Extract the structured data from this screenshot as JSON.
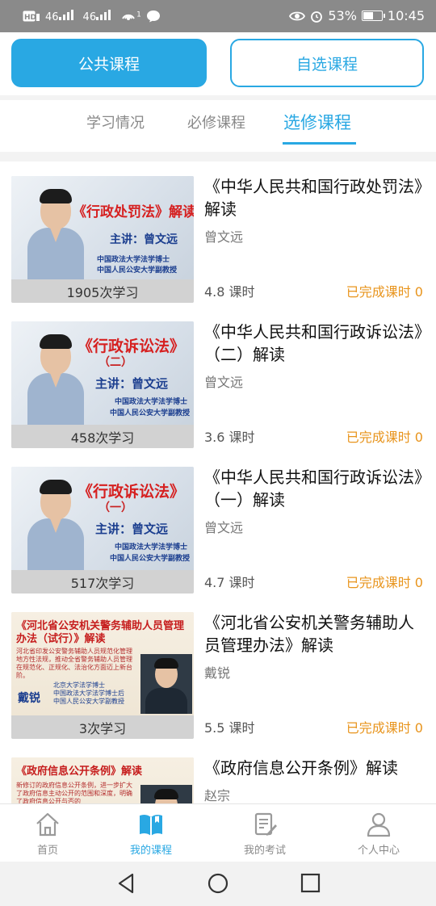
{
  "status_bar": {
    "left_icons": [
      "hd-icon",
      "4g-signal-icon",
      "4g-signal-icon",
      "hotspot-icon",
      "chat-icon"
    ],
    "signal_labels": [
      "46",
      "46"
    ],
    "hotspot_count": "1",
    "battery_percent": "53%",
    "battery_level": 0.53,
    "time": "10:45"
  },
  "top_buttons": {
    "public": "公共课程",
    "elective": "自选课程"
  },
  "tabs": [
    {
      "label": "学习情况",
      "active": false
    },
    {
      "label": "必修课程",
      "active": false
    },
    {
      "label": "选修课程",
      "active": true
    }
  ],
  "courses": [
    {
      "title": "《中华人民共和国行政处罚法》解读",
      "teacher": "曾文远",
      "hours": "4.8 课时",
      "completed": "已完成课时 0",
      "study_count": "1905次学习",
      "thumb": {
        "title": "《行政处罚法》解读",
        "sub": "",
        "speaker": "主讲：曾文远",
        "cred": [
          "中国政法大学法学博士",
          "中国人民公安大学副教授"
        ]
      }
    },
    {
      "title": "《中华人民共和国行政诉讼法》（二）解读",
      "teacher": "曾文远",
      "hours": "3.6 课时",
      "completed": "已完成课时 0",
      "study_count": "458次学习",
      "thumb": {
        "title": "《行政诉讼法》",
        "sub": "（二）",
        "speaker": "主讲：曾文远",
        "cred": [
          "中国政法大学法学博士",
          "中国人民公安大学副教授"
        ]
      }
    },
    {
      "title": "《中华人民共和国行政诉讼法》（一）解读",
      "teacher": "曾文远",
      "hours": "4.7 课时",
      "completed": "已完成课时 0",
      "study_count": "517次学习",
      "thumb": {
        "title": "《行政诉讼法》",
        "sub": "（一）",
        "speaker": "主讲：曾文远",
        "cred": [
          "中国政法大学法学博士",
          "中国人民公安大学副教授"
        ]
      }
    },
    {
      "title": "《河北省公安机关警务辅助人员管理办法》解读",
      "teacher": "戴锐",
      "hours": "5.5 课时",
      "completed": "已完成课时 0",
      "study_count": "3次学习",
      "thumb": {
        "title": "《河北省公安机关警务辅助人员管理办法（试行）》解读",
        "desc": "河北省印发公安警务辅助人员规范化管理地方性法规，推动全省警务辅助人员管理在规范化、正规化、法治化方面迈上新台阶。",
        "speaker": "戴锐",
        "cred": [
          "北京大学法学博士",
          "中国政法大学法学博士后",
          "中国人民公安大学副教授"
        ]
      }
    },
    {
      "title": "《政府信息公开条例》解读",
      "teacher": "赵宗",
      "hours": "",
      "completed": "",
      "study_count": "",
      "thumb": {
        "title": "《政府信息公开条例》解读",
        "desc": "新修订的政府信息公开条例，进一步扩大了政府信息主动公开的范围和深度，明确了政府信息公开与否的"
      }
    }
  ],
  "bottom_nav": [
    {
      "label": "首页",
      "icon": "home-icon",
      "active": false
    },
    {
      "label": "我的课程",
      "icon": "book-icon",
      "active": true
    },
    {
      "label": "我的考试",
      "icon": "exam-icon",
      "active": false
    },
    {
      "label": "个人中心",
      "icon": "person-icon",
      "active": false
    }
  ],
  "android_nav": [
    "back-icon",
    "home-circle-icon",
    "recents-icon"
  ],
  "colors": {
    "accent": "#29a8e3",
    "completed": "#e8941c",
    "status_bar": "#8a8a8a"
  }
}
